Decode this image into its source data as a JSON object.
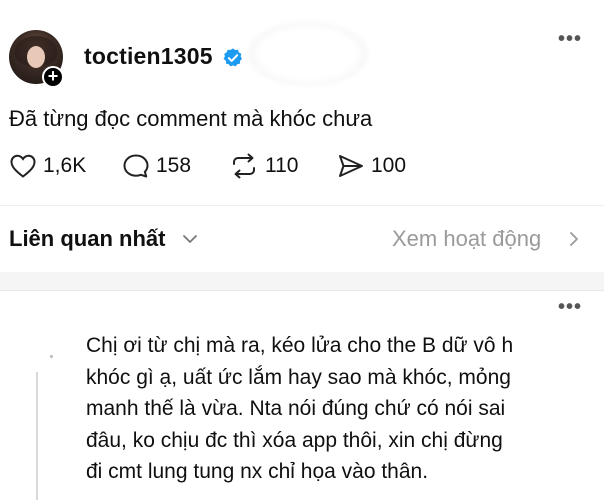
{
  "post": {
    "username": "toctien1305",
    "text": "Đã từng đọc comment mà khóc chưa",
    "stats": {
      "likes": "1,6K",
      "comments": "158",
      "reposts": "110",
      "shares": "100"
    }
  },
  "replies_header": {
    "sort_label": "Liên quan nhất",
    "activity_link": "Xem hoạt động"
  },
  "comment": {
    "lines": [
      "Chị ơi từ chị mà ra, kéo lửa cho the B dữ vô h",
      "khóc gì ạ, uất ức lắm hay sao mà khóc, mỏng",
      "manh thế là vừa. Nta nói đúng chứ có nói sai",
      "đâu, ko chịu đc thì xóa app thôi, xin chị đừng",
      "đi cmt lung tung nx chỉ họa vào thân."
    ]
  },
  "icons": [
    "plus-icon",
    "verified-icon",
    "more-icon",
    "heart-icon",
    "comment-icon",
    "repost-icon",
    "share-icon",
    "chevron-down-icon",
    "chevron-right-icon"
  ],
  "colors": {
    "verified": "#1d9bf0",
    "muted": "#9a9a9a",
    "text": "#101010"
  }
}
